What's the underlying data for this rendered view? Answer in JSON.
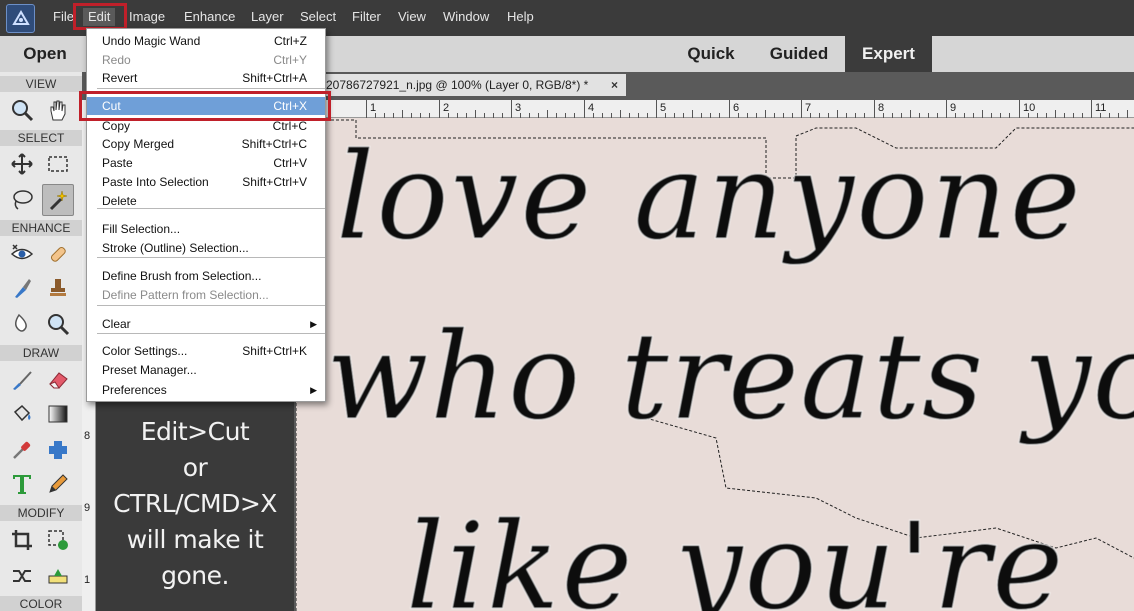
{
  "menubar": {
    "items": [
      "File",
      "Edit",
      "Image",
      "Enhance",
      "Layer",
      "Select",
      "Filter",
      "View",
      "Window",
      "Help"
    ],
    "active": "Edit"
  },
  "modebar": {
    "open_label": "Open",
    "modes": [
      "Quick",
      "Guided",
      "Expert"
    ],
    "active_mode": "Expert"
  },
  "tools": {
    "sections": [
      "VIEW",
      "SELECT",
      "ENHANCE",
      "DRAW",
      "MODIFY",
      "COLOR"
    ],
    "icons": [
      "zoom-icon",
      "hand-icon",
      "move-icon",
      "marquee-icon",
      "lasso-icon",
      "magic-wand-icon",
      "red-eye-icon",
      "spot-healing-icon",
      "smart-brush-icon",
      "clone-stamp-icon",
      "blur-icon",
      "sponge-icon",
      "brush-icon",
      "eraser-icon",
      "paint-bucket-icon",
      "gradient-icon",
      "eyedropper-icon",
      "shape-icon",
      "type-icon",
      "pencil-icon",
      "crop-icon",
      "recompose-icon",
      "content-aware-move-icon",
      "straighten-icon"
    ],
    "selected": "magic-wand-icon"
  },
  "document": {
    "tab_title": "20786727921_n.jpg @ 100% (Layer 0, RGB/8*) *",
    "close_glyph": "×"
  },
  "ruler": {
    "top_labels": [
      "1",
      "2",
      "3",
      "4",
      "5",
      "6",
      "7",
      "8",
      "9",
      "10",
      "11"
    ],
    "left_labels": [
      "8",
      "9",
      "1"
    ]
  },
  "canvas": {
    "lines": [
      "love anyone",
      "who treats you",
      "like you're"
    ]
  },
  "caption": {
    "text": "Edit>Cut\nor\nCTRL/CMD>X\nwill make it\ngone."
  },
  "edit_menu": {
    "items": [
      {
        "label": "Undo Magic Wand",
        "shortcut": "Ctrl+Z",
        "disabled": false
      },
      {
        "label": "Redo",
        "shortcut": "Ctrl+Y",
        "disabled": true
      },
      {
        "label": "Revert",
        "shortcut": "Shift+Ctrl+A",
        "disabled": false
      },
      {
        "label": "Cut",
        "shortcut": "Ctrl+X",
        "disabled": false,
        "highlighted": true
      },
      {
        "label": "Copy",
        "shortcut": "Ctrl+C",
        "disabled": false
      },
      {
        "label": "Copy Merged",
        "shortcut": "Shift+Ctrl+C",
        "disabled": false
      },
      {
        "label": "Paste",
        "shortcut": "Ctrl+V",
        "disabled": false
      },
      {
        "label": "Paste Into Selection",
        "shortcut": "Shift+Ctrl+V",
        "disabled": false
      },
      {
        "label": "Delete",
        "shortcut": "",
        "disabled": false
      },
      {
        "label": "Fill Selection...",
        "shortcut": "",
        "disabled": false
      },
      {
        "label": "Stroke (Outline) Selection...",
        "shortcut": "",
        "disabled": false
      },
      {
        "label": "Define Brush from Selection...",
        "shortcut": "",
        "disabled": false
      },
      {
        "label": "Define Pattern from Selection...",
        "shortcut": "",
        "disabled": true
      },
      {
        "label": "Clear",
        "shortcut": "",
        "disabled": false,
        "submenu": true
      },
      {
        "label": "Color Settings...",
        "shortcut": "Shift+Ctrl+K",
        "disabled": false
      },
      {
        "label": "Preset Manager...",
        "shortcut": "",
        "disabled": false
      },
      {
        "label": "Preferences",
        "shortcut": "",
        "disabled": false,
        "submenu": true
      }
    ],
    "submenu_glyph": "▶"
  },
  "colors": {
    "highlight_box": "#c0202a",
    "menu_hover": "#6f9fd8",
    "menubar_bg": "#3b3b3b",
    "canvas_bg": "#e7dcd8"
  }
}
